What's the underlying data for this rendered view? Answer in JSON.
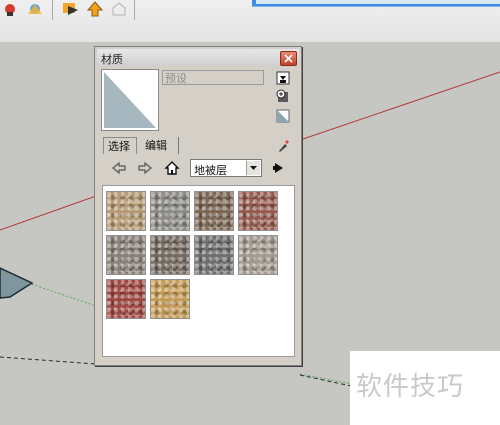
{
  "panel": {
    "title": "材质",
    "material_name_placeholder": "预设",
    "tabs": [
      {
        "label": "选择",
        "active": true
      },
      {
        "label": "编辑",
        "active": false
      }
    ],
    "library": {
      "selected": "地被层"
    }
  },
  "swatches": [
    {
      "name": "gravel-tan",
      "color": "#b59a74"
    },
    {
      "name": "gravel-gray",
      "color": "#8c8a86"
    },
    {
      "name": "pebbles-brown",
      "color": "#7b6651"
    },
    {
      "name": "gravel-red",
      "color": "#955a4d"
    },
    {
      "name": "gravel-mixed",
      "color": "#888078"
    },
    {
      "name": "gravel-dark-brown",
      "color": "#74695f"
    },
    {
      "name": "gravel-dark-gray",
      "color": "#6f6e6c"
    },
    {
      "name": "gravel-beige",
      "color": "#a29a8e"
    },
    {
      "name": "gravel-crimson",
      "color": "#9f4640"
    },
    {
      "name": "sand-ochre",
      "color": "#c49a56"
    }
  ],
  "watermark": {
    "text": "软件技巧"
  },
  "colors": {
    "background": "#c6c6c2",
    "axis_red": "#b23b3b",
    "axis_green": "#5aa85a",
    "edge_dark": "#2a2a2a",
    "shape_fill": "#7f969e"
  }
}
